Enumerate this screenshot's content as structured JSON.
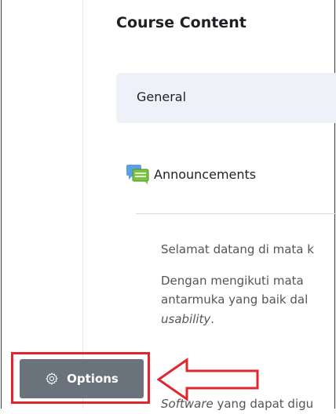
{
  "course": {
    "heading": "Course Content",
    "section": {
      "label": "General"
    },
    "activity": {
      "label": "Announcements",
      "icon": "forum-icon"
    },
    "description": {
      "line1": "Selamat datang di mata k",
      "line2": "Dengan mengikuti mata",
      "line3": "antarmuka yang baik dal",
      "line4_em": "usability",
      "line4_tail": ".",
      "line5_em": "Software",
      "line5_tail": " yang dapat digu"
    }
  },
  "options_button": {
    "label": "Options",
    "icon": "gear-icon"
  },
  "annotation": {
    "highlight_color": "#e0262e",
    "arrow_color": "#e0262e"
  }
}
